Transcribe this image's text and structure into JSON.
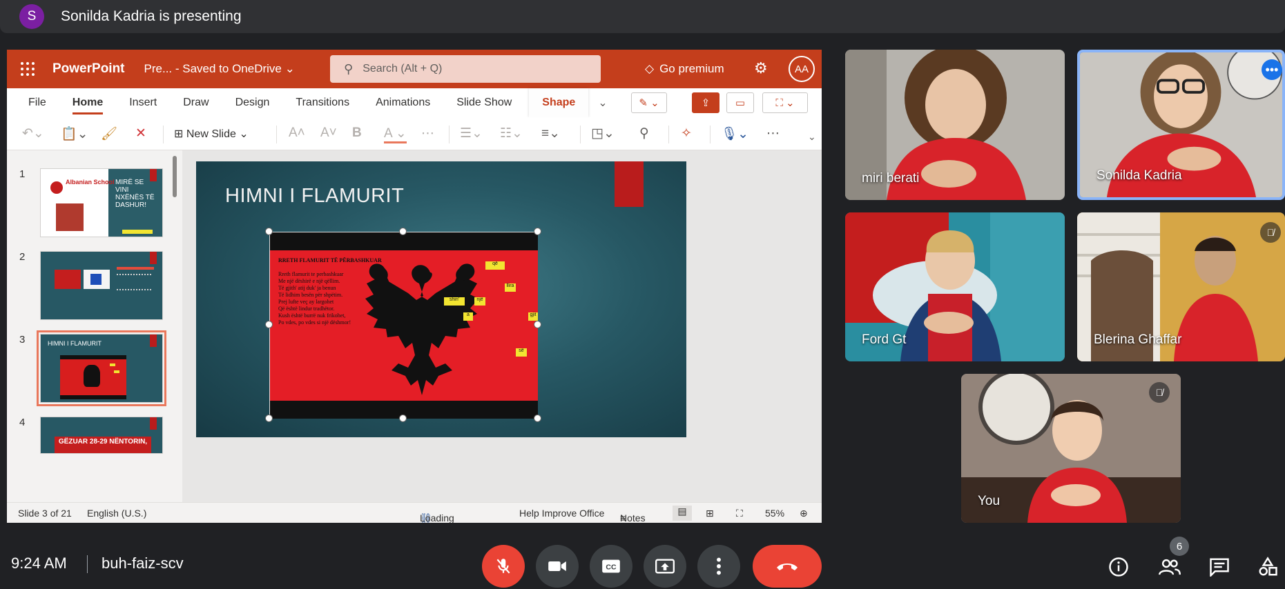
{
  "presenter": {
    "avatar_letter": "S",
    "text": "Sonilda Kadria is presenting"
  },
  "powerpoint": {
    "app_name": "PowerPoint",
    "doc_title": "Pre... - Saved to OneDrive",
    "search_placeholder": "Search (Alt + Q)",
    "premium_label": "Go premium",
    "account_initials": "AA",
    "tabs": [
      "File",
      "Home",
      "Insert",
      "Draw",
      "Design",
      "Transitions",
      "Animations",
      "Slide Show",
      "Shape"
    ],
    "active_tab": "Home",
    "ribbon": {
      "new_slide_label": "New Slide"
    },
    "thumbnails": [
      {
        "num": "1",
        "school": "Albanian School",
        "greeting": "MIRË SE VINI NXËNËS TË DASHUR!"
      },
      {
        "num": "2"
      },
      {
        "num": "3",
        "title": "HIMNI I FLAMURIT"
      },
      {
        "num": "4",
        "banner": "GËZUAR 28-29 NËNTORIN,"
      }
    ],
    "slide": {
      "title": "HIMNI I FLAMURIT",
      "poem_title": "RRETH FLAMURIT TË PËRBASHKUAR",
      "poem_lines": [
        "Rreth flamurit te perbashkuar",
        "Me një dëshirë e një qëllim.",
        "Të gjith' atij duk' ja benun",
        "Të lidhim besën për shpëtim.",
        "Prej lufte veç ay largohet",
        "Që është lindur tradhëtor.",
        "Kush është burrë nuk frikohet,",
        "Po vdes, po vdes si një dëshmor!"
      ],
      "yellow_tags": [
        "që",
        "llira",
        "shin'",
        "një",
        "a",
        "gjit",
        "së"
      ]
    },
    "status": {
      "slide_count": "Slide 3 of 21",
      "language": "English (U.S.)",
      "addins": "Loading Add-ins",
      "help": "Help Improve Office",
      "notes": "Notes",
      "zoom": "55%"
    }
  },
  "participants": [
    {
      "name": "miri berati",
      "muted": false,
      "active_speaker": false
    },
    {
      "name": "Sonilda Kadria",
      "muted": false,
      "active_speaker": true
    },
    {
      "name": "Ford Gt",
      "muted": false,
      "active_speaker": false
    },
    {
      "name": "Blerina Ghaffar",
      "muted": true,
      "active_speaker": false
    },
    {
      "name": "You",
      "muted": true,
      "active_speaker": false
    }
  ],
  "meeting": {
    "time": "9:24 AM",
    "code": "buh-faiz-scv",
    "people_count": "6"
  },
  "colors": {
    "ppt_accent": "#c43e1c",
    "meet_red": "#ea4335",
    "active_speaker_border": "#8ab4f8"
  }
}
